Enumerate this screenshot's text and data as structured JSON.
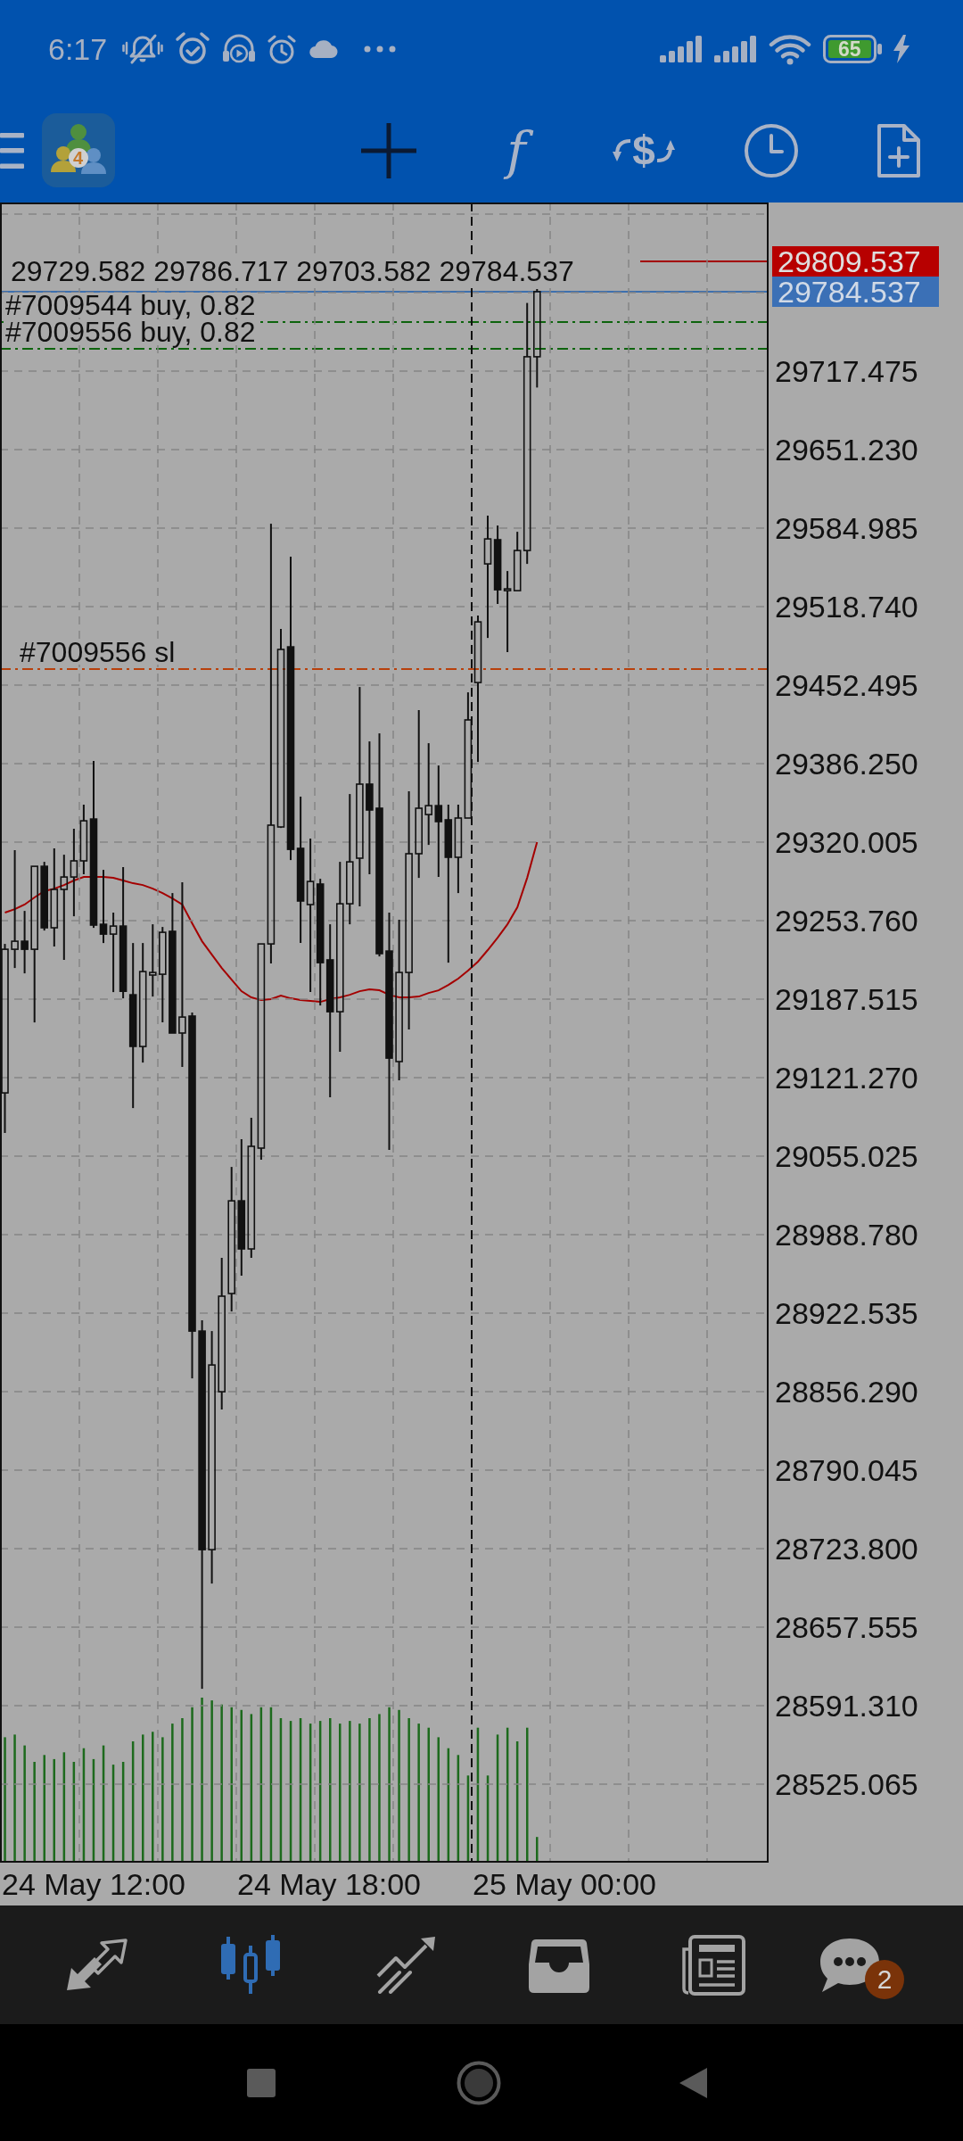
{
  "status_bar": {
    "time": "6:17",
    "battery": "65"
  },
  "toolbar": {
    "logo_text": "4",
    "function_symbol": "f",
    "currency_symbol": "$"
  },
  "chart": {
    "info": "29729.582 29786.717 29703.582 29784.537",
    "price_tags": [
      {
        "kind": "ask",
        "text": "29809.537"
      },
      {
        "kind": "bid",
        "text": "29784.537"
      }
    ],
    "order_lines": [
      {
        "kind": "buy",
        "label": "#7009544 buy, 0.82"
      },
      {
        "kind": "buy",
        "label": "#7009556 buy, 0.82"
      },
      {
        "kind": "sl",
        "label": "#7009556 sl"
      }
    ],
    "chart_data": {
      "type": "candlestick",
      "grid": true,
      "categories": [
        null,
        null,
        null,
        null,
        null,
        null,
        null,
        null,
        null,
        null,
        null,
        null,
        null,
        null,
        null,
        null,
        null,
        null,
        null,
        null,
        null,
        null,
        null,
        null,
        null,
        null,
        null,
        null,
        null,
        null,
        null,
        null,
        null,
        null,
        null,
        null,
        null,
        null,
        null,
        null,
        null,
        null,
        null,
        null,
        null,
        null,
        null,
        null,
        null,
        null,
        null,
        null,
        null,
        null,
        null,
        null,
        null,
        null,
        null,
        null,
        null,
        null,
        null,
        null,
        null,
        null,
        null,
        null,
        null,
        null,
        null,
        null,
        null,
        null,
        null,
        null,
        null,
        null
      ],
      "ohlc": [
        [
          29108.4,
          29234.1,
          29074.6,
          29229.6
        ],
        [
          29229.6,
          29313.2,
          29213.8,
          29236.4
        ],
        [
          29236.4,
          29262.0,
          29209.3,
          29229.6
        ],
        [
          29229.6,
          29299.6,
          29167.9,
          29299.6
        ],
        [
          29299.6,
          29303.4,
          29245.4,
          29247.7
        ],
        [
          29247.7,
          29314.7,
          29231.9,
          29280.1
        ],
        [
          29280.1,
          29309.4,
          29220.6,
          29290.6
        ],
        [
          29290.6,
          29331.3,
          29257.5,
          29304.2
        ],
        [
          29304.2,
          29351.6,
          29292.9,
          29338.0
        ],
        [
          29339.5,
          29388.5,
          29247.7,
          29250.0
        ],
        [
          29250.7,
          29296.6,
          29234.9,
          29242.4
        ],
        [
          29242.4,
          29260.5,
          29193.5,
          29249.2
        ],
        [
          29249.2,
          29298.9,
          29188.2,
          29194.2
        ],
        [
          29191.2,
          29234.9,
          29095.6,
          29147.6
        ],
        [
          29147.6,
          29234.9,
          29134.0,
          29210.8
        ],
        [
          29207.8,
          29250.7,
          29189.7,
          29210.0
        ],
        [
          29208.5,
          29248.4,
          29167.9,
          29243.9
        ],
        [
          29244.7,
          29277.0,
          29158.9,
          29158.9
        ],
        [
          29158.9,
          29286.1,
          29130.3,
          29172.4
        ],
        [
          29173.2,
          29176.2,
          28867.5,
          28907.4
        ],
        [
          28907.4,
          28916.5,
          28605.6,
          28723.0
        ],
        [
          28723.0,
          28907.4,
          28694.4,
          28878.8
        ],
        [
          28856.2,
          28969.2,
          28841.2,
          28936.8
        ],
        [
          28939.1,
          29045.9,
          28924.0,
          29017.3
        ],
        [
          29017.3,
          29069.3,
          28954.1,
          28976.7
        ],
        [
          28976.7,
          29087.4,
          28969.2,
          29063.3
        ],
        [
          29061.8,
          29234.1,
          29052.0,
          29234.1
        ],
        [
          29234.1,
          29588.7,
          29217.6,
          29334.3
        ],
        [
          29332.8,
          29499.9,
          29332.0,
          29482.6
        ],
        [
          29484.8,
          29560.9,
          29304.9,
          29313.9
        ],
        [
          29314.7,
          29358.4,
          29234.9,
          29270.3
        ],
        [
          29267.3,
          29323.0,
          29193.5,
          29286.8
        ],
        [
          29284.6,
          29289.1,
          29182.2,
          29218.3
        ],
        [
          29220.6,
          29250.7,
          29104.7,
          29176.9
        ],
        [
          29176.9,
          29303.4,
          29143.1,
          29268.0
        ],
        [
          29268.0,
          29360.6,
          29250.7,
          29303.4
        ],
        [
          29306.4,
          29450.9,
          29265.8,
          29368.9
        ],
        [
          29368.9,
          29405.0,
          29292.9,
          29347.1
        ],
        [
          29348.6,
          29411.8,
          29223.6,
          29225.9
        ],
        [
          29228.1,
          29260.5,
          29060.3,
          29137.8
        ],
        [
          29134.8,
          29254.5,
          29119.0,
          29210.0
        ],
        [
          29210.0,
          29362.9,
          29161.9,
          29310.2
        ],
        [
          29310.2,
          29431.4,
          29289.8,
          29348.6
        ],
        [
          29343.3,
          29403.5,
          29317.7,
          29350.8
        ],
        [
          29350.8,
          29384.7,
          29290.6,
          29337.3
        ],
        [
          29338.8,
          29351.6,
          29218.3,
          29307.2
        ],
        [
          29307.2,
          29351.6,
          29277.0,
          29340.3
        ],
        [
          29340.3,
          29446.4,
          29340.3,
          29423.1
        ],
        [
          29454.7,
          29511.2,
          29387.7,
          29505.9
        ],
        [
          29554.8,
          29595.5,
          29492.3,
          29575.9
        ],
        [
          29575.2,
          29587.2,
          29521.0,
          29533.0
        ],
        [
          29532.2,
          29548.8,
          29480.3,
          29533.7
        ],
        [
          29532.2,
          29581.9,
          29532.2,
          29566.1
        ],
        [
          29566.1,
          29775.0,
          29554.8,
          29729.6
        ],
        [
          29729.582,
          29786.717,
          29703.582,
          29784.537
        ],
        null,
        null,
        null,
        null,
        null,
        null,
        null,
        null,
        null,
        null,
        null,
        null,
        null,
        null,
        null,
        null,
        null,
        null,
        null,
        null,
        null,
        null,
        null
      ],
      "ylim": [
        28458.82,
        29859.75
      ],
      "yticks": [
        {
          "value": 29717.475,
          "label": "29717.475"
        },
        {
          "value": 29651.23,
          "label": "29651.230"
        },
        {
          "value": 29584.985,
          "label": "29584.985"
        },
        {
          "value": 29518.74,
          "label": "29518.740"
        },
        {
          "value": 29452.495,
          "label": "29452.495"
        },
        {
          "value": 29386.25,
          "label": "29386.250"
        },
        {
          "value": 29320.005,
          "label": "29320.005"
        },
        {
          "value": 29253.76,
          "label": "29253.760"
        },
        {
          "value": 29187.515,
          "label": "29187.515"
        },
        {
          "value": 29121.27,
          "label": "29121.270"
        },
        {
          "value": 29055.025,
          "label": "29055.025"
        },
        {
          "value": 28988.78,
          "label": "28988.780"
        },
        {
          "value": 28922.535,
          "label": "28922.535"
        },
        {
          "value": 28856.29,
          "label": "28856.290"
        },
        {
          "value": 28790.045,
          "label": "28790.045"
        },
        {
          "value": 28723.8,
          "label": "28723.800"
        },
        {
          "value": 28657.555,
          "label": "28657.555"
        },
        {
          "value": 28591.31,
          "label": "28591.310"
        },
        {
          "value": 28525.065,
          "label": "28525.065"
        }
      ]
    },
    "time_axis": [
      "24 May 12:00",
      "24 May 18:00",
      "25 May 00:00"
    ]
  },
  "bottom_nav": {
    "tabs": [
      {
        "kind": "arrows",
        "selected": false
      },
      {
        "kind": "candles",
        "selected": true
      },
      {
        "kind": "trend",
        "selected": false
      },
      {
        "kind": "inbox",
        "selected": false
      },
      {
        "kind": "news",
        "selected": false
      },
      {
        "kind": "chat",
        "selected": false,
        "badge": "2"
      }
    ]
  }
}
